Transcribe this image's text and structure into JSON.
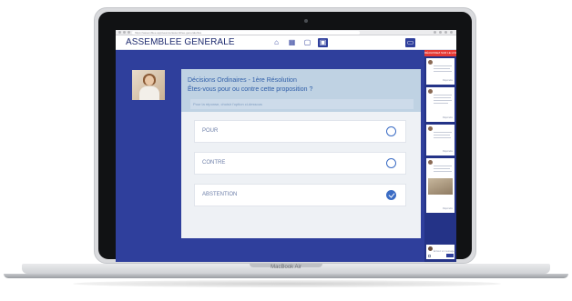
{
  "device": {
    "brand_label": "MacBook Air"
  },
  "browser": {
    "url": "https://assemblee.app/seance/assemblee-generale/live"
  },
  "header": {
    "title": "ASSEMBLEE GENERALE",
    "nav_icons": [
      "home-icon",
      "grid-icon",
      "window-icon",
      "presentation-icon"
    ],
    "right_icons": [
      "screen-icon",
      "help-icon"
    ],
    "user_initial": "A",
    "user_name": "user"
  },
  "question": {
    "title": "Décisions Ordinaires - 1ère Résolution",
    "subtitle": "Êtes-vous pour ou contre cette proposition ?",
    "note": "Pour la réponse, choisir l'option ci-dessous",
    "options": [
      {
        "label": "POUR",
        "selected": false
      },
      {
        "label": "CONTRE",
        "selected": false
      },
      {
        "label": "ABSTENTION",
        "selected": true
      }
    ]
  },
  "sidebar": {
    "live_label": "RÉAGISSEZ SUR LE LIVE",
    "posts": [
      {
        "name": "",
        "foot": "Répondre"
      },
      {
        "name": "",
        "foot": "Répondre"
      },
      {
        "name": "",
        "foot": "Répondre"
      },
      {
        "name": "",
        "foot": "Répondre"
      }
    ],
    "composer_name": "",
    "composer_placeholder": "Écrivez un message...",
    "send_label": "Envoyer"
  },
  "colors": {
    "primary": "#2f3f9c",
    "card_header": "#bfd2e3",
    "accent": "#3b6cc4",
    "live": "#e53935"
  }
}
